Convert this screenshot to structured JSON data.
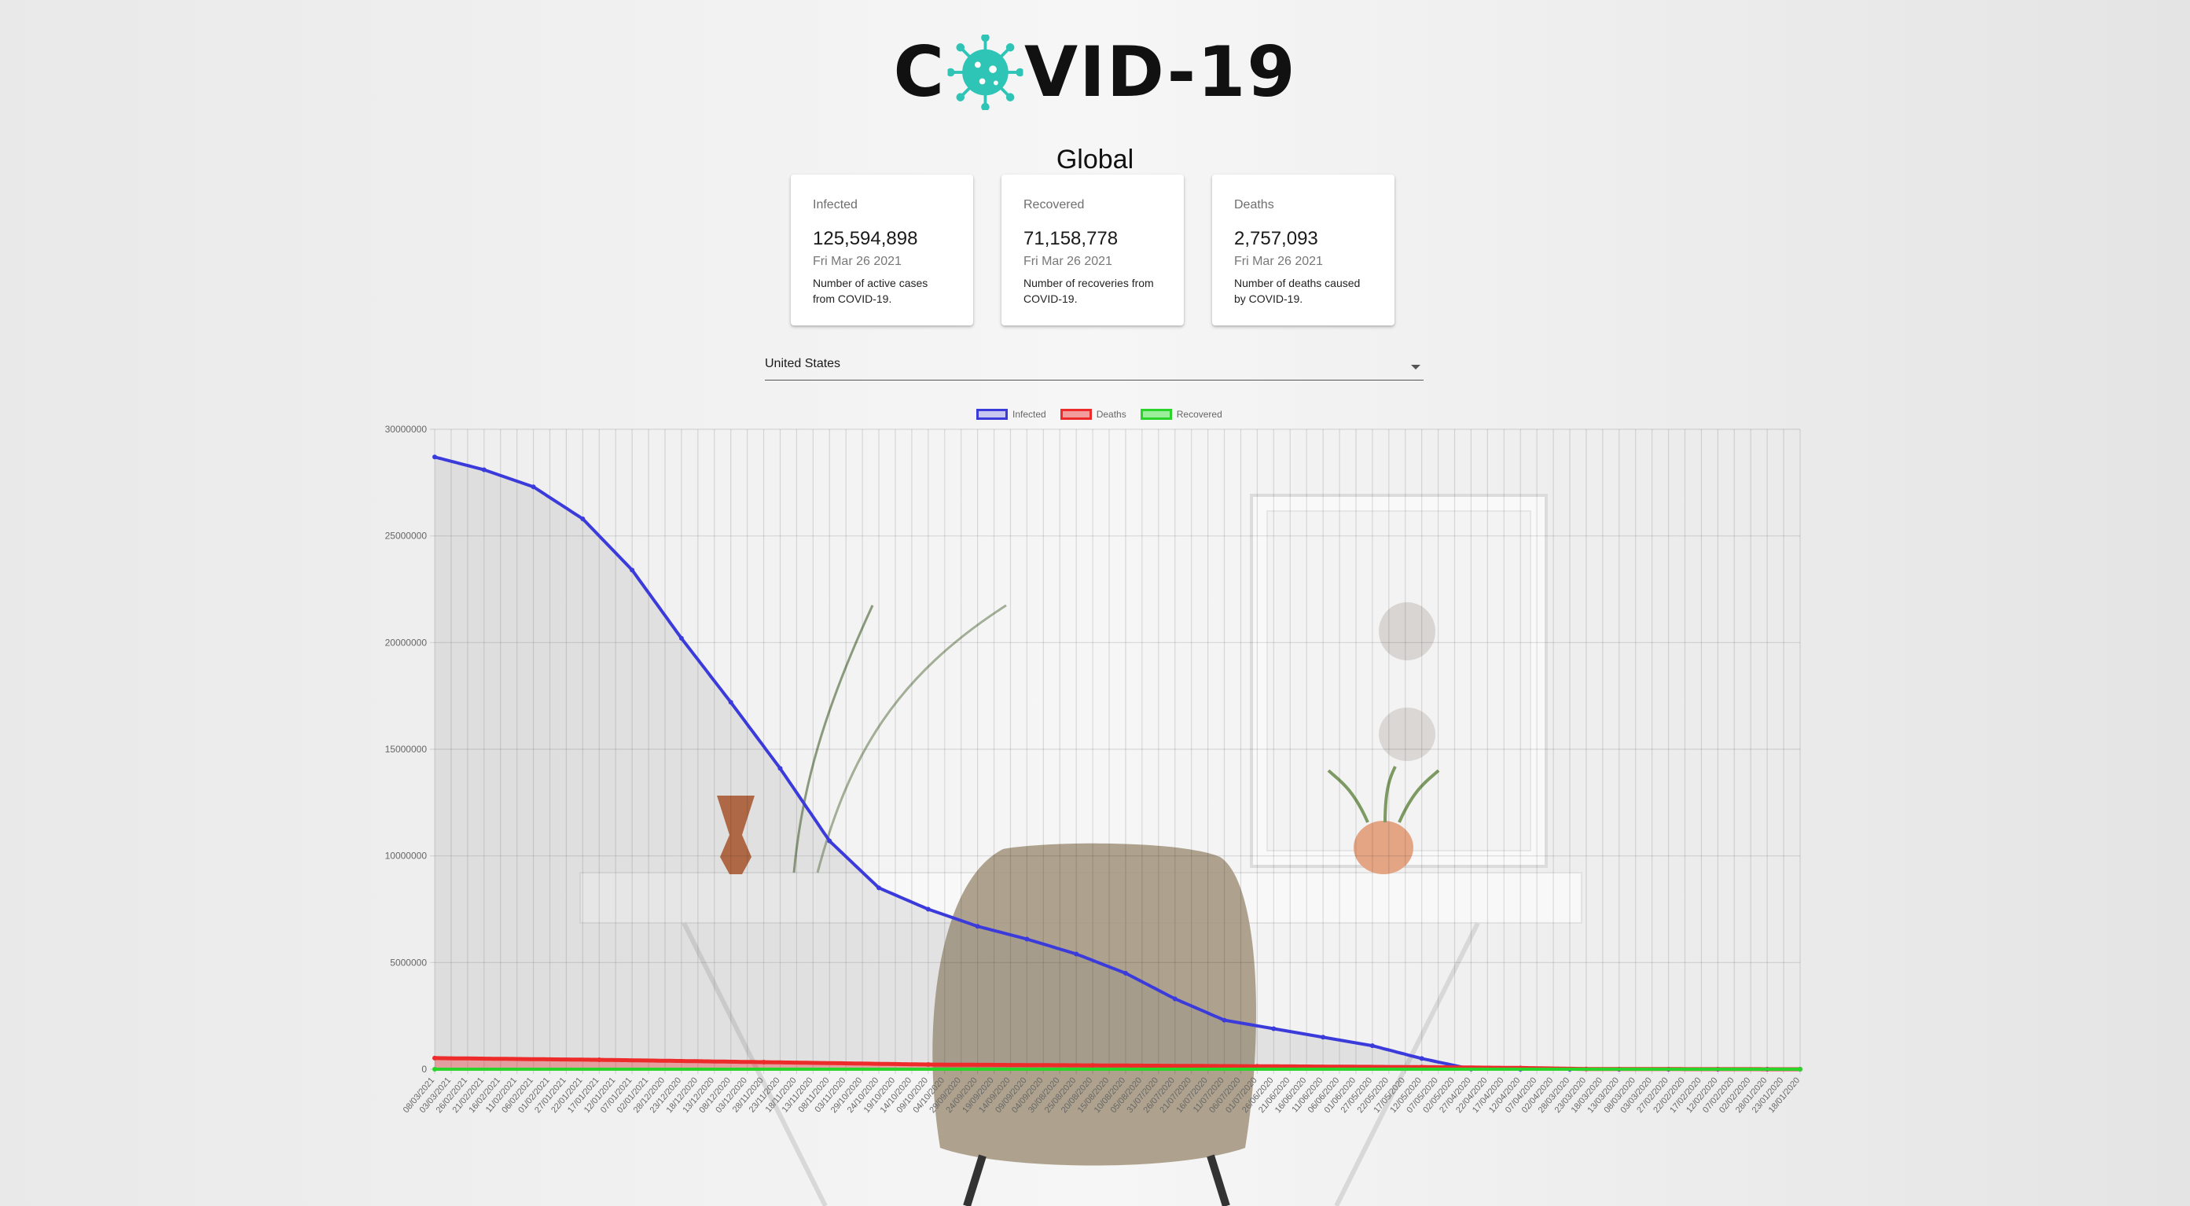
{
  "logo": {
    "text_left": "C",
    "text_right": "VID-19",
    "icon": "virus-icon"
  },
  "region_title": "Global",
  "cards": [
    {
      "label": "Infected",
      "value": "125,594,898",
      "date": "Fri Mar 26 2021",
      "description": "Number of active cases from COVID-19."
    },
    {
      "label": "Recovered",
      "value": "71,158,778",
      "date": "Fri Mar 26 2021",
      "description": "Number of recoveries from COVID-19."
    },
    {
      "label": "Deaths",
      "value": "2,757,093",
      "date": "Fri Mar 26 2021",
      "description": "Number of deaths caused by COVID-19."
    }
  ],
  "country_select": {
    "value": "United States",
    "icon": "caret-down-icon"
  },
  "colors": {
    "infected": "#3b3bdc",
    "deaths": "#ee2b2b",
    "recovered": "#2bd42b",
    "virus": "#2ec4b6"
  },
  "chart_data": {
    "type": "line",
    "legend": [
      "Infected",
      "Deaths",
      "Recovered"
    ],
    "legend_position": "top",
    "grid": true,
    "ylim": [
      0,
      30000000
    ],
    "y_ticks": [
      "0",
      "5000000",
      "10000000",
      "15000000",
      "20000000",
      "25000000",
      "30000000"
    ],
    "x_tick_labels": [
      "08/03/2021",
      "03/03/2021",
      "26/02/2021",
      "21/02/2021",
      "16/02/2021",
      "11/02/2021",
      "06/02/2021",
      "01/02/2021",
      "27/01/2021",
      "22/01/2021",
      "17/01/2021",
      "12/01/2021",
      "07/01/2021",
      "02/01/2021",
      "28/12/2020",
      "23/12/2020",
      "18/12/2020",
      "13/12/2020",
      "08/12/2020",
      "03/12/2020",
      "28/11/2020",
      "23/11/2020",
      "18/11/2020",
      "13/11/2020",
      "08/11/2020",
      "03/11/2020",
      "29/10/2020",
      "24/10/2020",
      "19/10/2020",
      "14/10/2020",
      "09/10/2020",
      "04/10/2020",
      "29/09/2020",
      "24/09/2020",
      "19/09/2020",
      "14/09/2020",
      "09/09/2020",
      "04/09/2020",
      "30/08/2020",
      "25/08/2020",
      "20/08/2020",
      "15/08/2020",
      "10/08/2020",
      "05/08/2020",
      "31/07/2020",
      "26/07/2020",
      "21/07/2020",
      "16/07/2020",
      "11/07/2020",
      "06/07/2020",
      "01/07/2020",
      "26/06/2020",
      "21/06/2020",
      "16/06/2020",
      "11/06/2020",
      "06/06/2020",
      "01/06/2020",
      "27/05/2020",
      "22/05/2020",
      "17/05/2020",
      "12/05/2020",
      "07/05/2020",
      "02/05/2020",
      "27/04/2020",
      "22/04/2020",
      "17/04/2020",
      "12/04/2020",
      "07/04/2020",
      "02/04/2020",
      "28/03/2020",
      "23/03/2020",
      "18/03/2020",
      "13/03/2020",
      "08/03/2020",
      "03/03/2020",
      "27/02/2020",
      "22/02/2020",
      "17/02/2020",
      "12/02/2020",
      "07/02/2020",
      "02/02/2020",
      "28/01/2020",
      "23/01/2020",
      "18/01/2020"
    ],
    "series": [
      {
        "name": "Infected",
        "x_index": [
          0,
          3,
          6,
          9,
          12,
          15,
          18,
          21,
          24,
          27,
          30,
          33,
          36,
          39,
          42,
          45,
          48,
          51,
          54,
          57,
          60,
          63,
          66,
          69,
          72,
          75,
          78,
          81,
          83
        ],
        "values": [
          28700000,
          28100000,
          27300000,
          25800000,
          23400000,
          20200000,
          17200000,
          14100000,
          10700000,
          8500000,
          7500000,
          6700000,
          6100000,
          5400000,
          4500000,
          3300000,
          2300000,
          1900000,
          1500000,
          1100000,
          500000,
          10000,
          0,
          0,
          0,
          0,
          0,
          0,
          0
        ]
      },
      {
        "name": "Deaths",
        "x_index": [
          0,
          10,
          20,
          30,
          40,
          50,
          60,
          66,
          70,
          83
        ],
        "values": [
          520000,
          440000,
          330000,
          220000,
          180000,
          140000,
          100000,
          60000,
          10000,
          0
        ]
      },
      {
        "name": "Recovered",
        "x_index": [
          0,
          83
        ],
        "values": [
          0,
          0
        ]
      }
    ]
  }
}
